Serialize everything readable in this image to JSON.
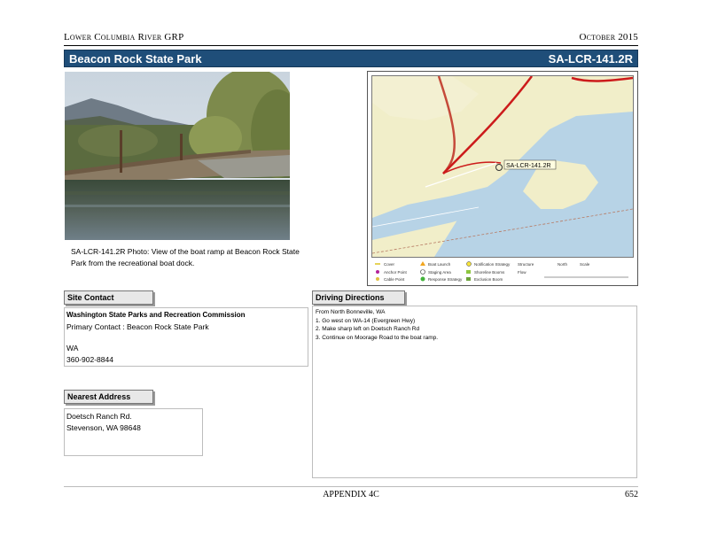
{
  "header": {
    "left": "Lower Columbia River GRP",
    "right": "October 2015"
  },
  "titlebar": {
    "name": "Beacon Rock State Park",
    "code": "SA-LCR-141.2R"
  },
  "photo": {
    "caption": "SA-LCR-141.2R Photo: View of the boat ramp at Beacon Rock State Park from the recreational boat dock."
  },
  "map": {
    "site_label": "SA-LCR-141.2R",
    "legend": [
      "Cover",
      "Anchor Point",
      "Cable Point",
      "Boat Launch",
      "Staging Area",
      "Response Strategy",
      "Notification Strategy",
      "Shoreline Booms",
      "Exclusion Boom",
      "Structure",
      "Flow",
      "Scale",
      "North"
    ]
  },
  "site_contact": {
    "label": "Site Contact",
    "org": "Washington State Parks and Recreation Commission",
    "primary": "Primary Contact : Beacon Rock State Park",
    "state": "WA",
    "phone": "360-902-8844"
  },
  "nearest_address": {
    "label": "Nearest Address",
    "line1": "Doetsch Ranch Rd.",
    "line2": "Stevenson, WA  98648"
  },
  "driving": {
    "label": "Driving Directions",
    "lines": [
      "From North Bonneville, WA",
      "1. Go west on WA-14 (Evergreen Hwy)",
      "2. Make sharp left on Doetsch Ranch Rd",
      "3. Continue on Moorage Road to the boat ramp."
    ]
  },
  "footer": {
    "center": "APPENDIX 4C",
    "page": "652"
  }
}
